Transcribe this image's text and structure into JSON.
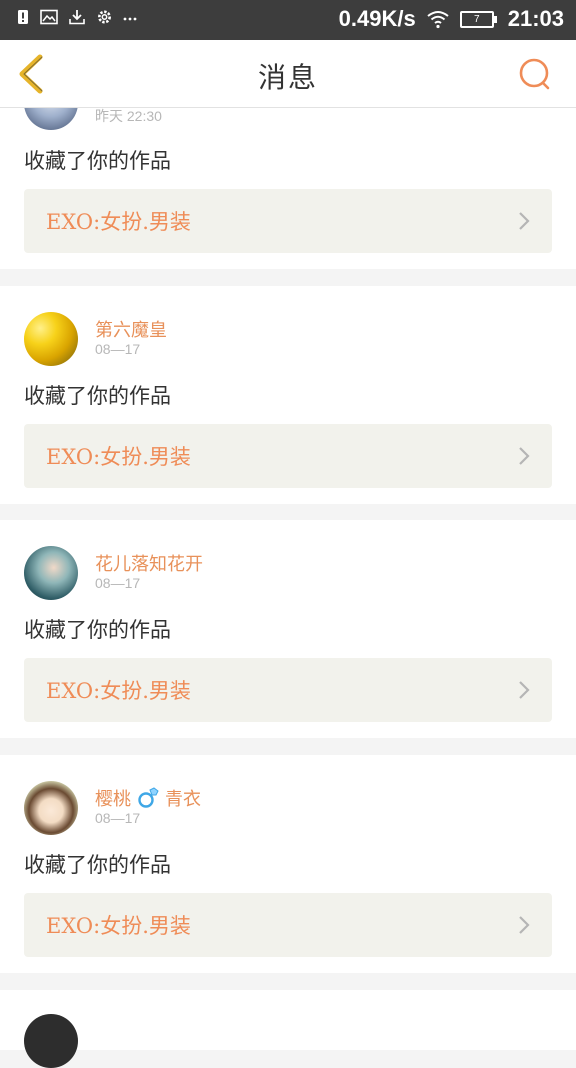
{
  "status_bar": {
    "net_speed": "0.49K/s",
    "battery": "7",
    "time": "21:03"
  },
  "header": {
    "title": "消息"
  },
  "messages": [
    {
      "user": "",
      "date": "昨天 22:30",
      "action": "收藏了你的作品",
      "work": "EXO:女扮.男装"
    },
    {
      "user": "第六魔皇",
      "date": "08—17",
      "action": "收藏了你的作品",
      "work": "EXO:女扮.男装"
    },
    {
      "user": "花儿落知花开",
      "date": "08—17",
      "action": "收藏了你的作品",
      "work": "EXO:女扮.男装"
    },
    {
      "user": "樱桃",
      "user_suffix": "青衣",
      "date": "08—17",
      "action": "收藏了你的作品",
      "work": "EXO:女扮.男装"
    },
    {
      "user": "",
      "date": "",
      "action": "",
      "work": ""
    }
  ],
  "colors": {
    "accent": "#ef8c57",
    "back_arrow": "#e6b42a"
  },
  "icons": {
    "back": "chevron-left-icon",
    "search": "search-icon",
    "row_arrow": "chevron-right-icon"
  }
}
